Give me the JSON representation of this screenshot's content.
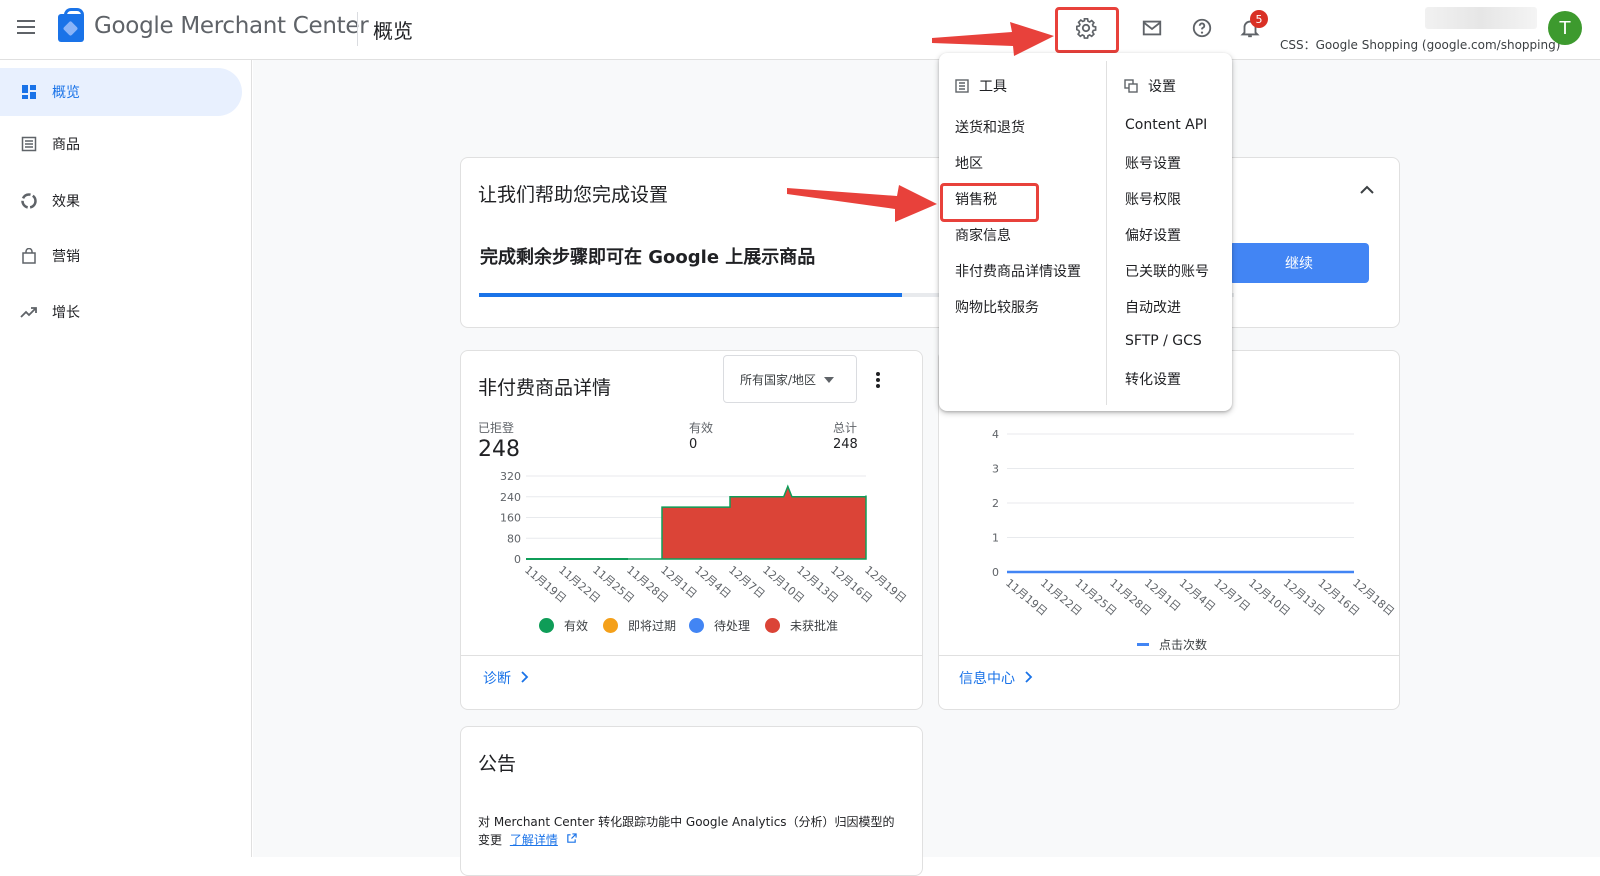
{
  "header": {
    "brand": "Google Merchant Center",
    "page_title": "概览",
    "notification_count": "5",
    "css_label": "CSS：Google Shopping (google.com/shopping)",
    "avatar_letter": "T"
  },
  "sidebar": {
    "items": [
      {
        "label": "概览",
        "icon": "dashboard-icon",
        "active": true
      },
      {
        "label": "商品",
        "icon": "list-icon"
      },
      {
        "label": "效果",
        "icon": "donut-icon"
      },
      {
        "label": "营销",
        "icon": "bag-icon"
      },
      {
        "label": "增长",
        "icon": "trending-up-icon"
      }
    ]
  },
  "setup_card": {
    "title": "让我们帮助您完成设置",
    "subtitle": "完成剩余步骤即可在 Google 上展示商品",
    "button": "继续",
    "progress": 0.56
  },
  "products_card": {
    "title": "非付费商品详情",
    "region_select": "所有国家/地区",
    "stats": [
      {
        "label": "已拒登",
        "value": "248"
      },
      {
        "label": "有效",
        "value": "0"
      },
      {
        "label": "总计",
        "value": "248"
      }
    ],
    "link": "诊断"
  },
  "clicks_card": {
    "link": "信息中心"
  },
  "announcement_card": {
    "title": "公告",
    "text": "对 Merchant Center 转化跟踪功能中 Google Analytics（分析）归因模型的",
    "text2": "变更",
    "link": "了解详情"
  },
  "settings_menu": {
    "tools_heading": "工具",
    "tools": [
      "送货和退货",
      "地区",
      "销售税",
      "商家信息",
      "非付费商品详情设置",
      "购物比较服务"
    ],
    "settings_heading": "设置",
    "settings": [
      "Content API",
      "账号设置",
      "账号权限",
      "偏好设置",
      "已关联的账号",
      "自动改进",
      "SFTP / GCS",
      "转化设置"
    ]
  },
  "colors": {
    "accent": "#1a73e8",
    "button": "#4285f4",
    "annotation": "#e8413b",
    "rejected": "#db4437",
    "valid": "#0f9d58",
    "expiring": "#f4a01a",
    "pending": "#4285f4"
  },
  "chart_data": [
    {
      "type": "area",
      "x": [
        "11月19日",
        "11月22日",
        "11月25日",
        "11月28日",
        "12月1日",
        "12月4日",
        "12月7日",
        "12月10日",
        "12月13日",
        "12月16日",
        "12月19日"
      ],
      "series": [
        {
          "name": "有效",
          "color": "#0f9d58",
          "values": [
            0,
            0,
            0,
            0,
            200,
            200,
            240,
            240,
            240,
            240,
            245
          ]
        },
        {
          "name": "即将过期",
          "color": "#f4a01a",
          "values": []
        },
        {
          "name": "待处理",
          "color": "#4285f4",
          "values": []
        },
        {
          "name": "未获批准",
          "color": "#db4437",
          "values": [
            0,
            0,
            0,
            0,
            200,
            200,
            240,
            240,
            240,
            240,
            245
          ]
        }
      ],
      "peak": {
        "x": "12月11日",
        "value": 280
      },
      "yticks": [
        0,
        80,
        160,
        240,
        320
      ],
      "ylim": [
        0,
        320
      ]
    },
    {
      "type": "line",
      "x": [
        "11月19日",
        "11月22日",
        "11月25日",
        "11月28日",
        "12月1日",
        "12月4日",
        "12月7日",
        "12月10日",
        "12月13日",
        "12月16日",
        "12月18日"
      ],
      "series": [
        {
          "name": "点击次数",
          "color": "#4285f4",
          "values": [
            0,
            0,
            0,
            0,
            0,
            0,
            0,
            0,
            0,
            0,
            0
          ]
        }
      ],
      "yticks": [
        0,
        1,
        2,
        3,
        4
      ],
      "ylim": [
        0,
        4
      ]
    }
  ]
}
